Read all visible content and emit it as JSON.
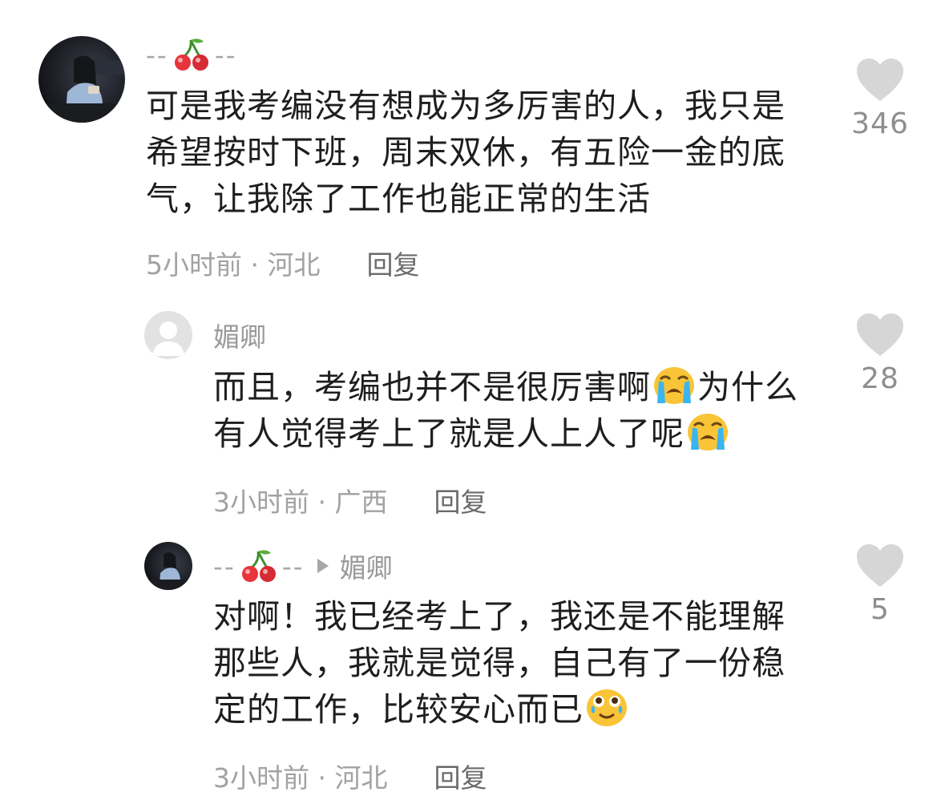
{
  "comments": [
    {
      "username_dashes_left": "--",
      "username_icon": "cherry-icon",
      "username_dashes_right": "--",
      "text": "可是我考编没有想成为多厉害的人，我只是希望按时下班，周末双休，有五险一金的底气，让我除了工作也能正常的生活",
      "time_location": "5小时前 · 河北",
      "reply_label": "回复",
      "likes": "346"
    },
    {
      "username": "媚卿",
      "text_part1": "而且，考编也并不是很厉害啊",
      "emoji1": "loudly-crying-face-icon",
      "text_part2": "为什么有人觉得考上了就是人上人了呢",
      "emoji2": "loudly-crying-face-icon",
      "time_location": "3小时前 · 广西",
      "reply_label": "回复",
      "likes": "28"
    },
    {
      "username_dashes_left": "--",
      "username_icon": "cherry-icon",
      "username_dashes_right": "--",
      "reply_to": "媚卿",
      "text": "对啊！我已经考上了，我还是不能理解那些人，我就是觉得，自己有了一份稳定的工作，比较安心而已",
      "emoji": "face-holding-back-tears-icon",
      "time_location": "3小时前 · 河北",
      "reply_label": "回复",
      "likes": "5"
    }
  ],
  "colors": {
    "text": "#1e1e1e",
    "meta": "#a2a2a2",
    "heart": "#d6d6d6",
    "cherry": "#e8343a"
  }
}
